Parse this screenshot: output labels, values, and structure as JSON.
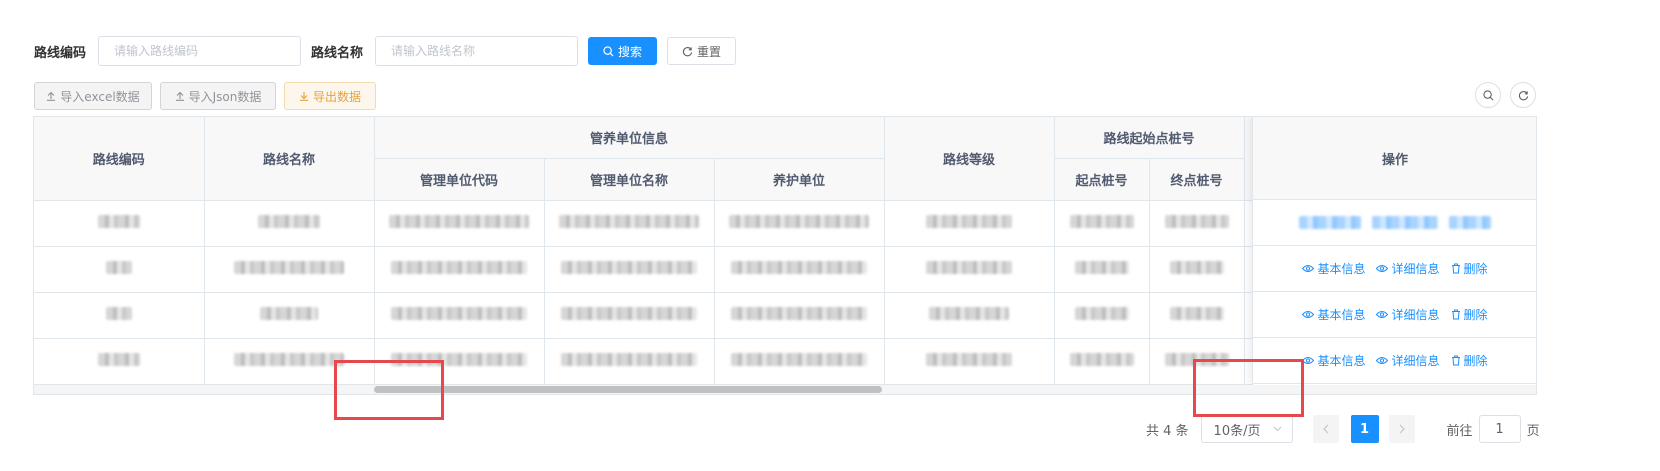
{
  "search": {
    "code_label": "路线编码",
    "code_placeholder": "请输入路线编码",
    "name_label": "路线名称",
    "name_placeholder": "请输入路线名称",
    "search_btn": "搜索",
    "reset_btn": "重置"
  },
  "toolbar": {
    "import_excel": "导入excel数据",
    "import_json": "导入Json数据",
    "export": "导出数据"
  },
  "table": {
    "headers": {
      "route_code": "路线编码",
      "route_name": "路线名称",
      "mgmt_group": "管养单位信息",
      "mgmt_code": "管理单位代码",
      "mgmt_name": "管理单位名称",
      "maint_unit": "养护单位",
      "route_level": "路线等级",
      "stake_group": "路线起始点桩号",
      "start_stake": "起点桩号",
      "end_stake": "终点桩号",
      "actions": "操作"
    },
    "row_count": 4,
    "row_actions": {
      "basic_info": "基本信息",
      "detail_info": "详细信息",
      "delete": "删除"
    }
  },
  "pagination": {
    "total": "共 4 条",
    "page_size": "10条/页",
    "current_page": "1",
    "goto_label": "前往",
    "goto_value": "1",
    "page_unit": "页"
  },
  "colors": {
    "primary": "#1890ff",
    "warning": "#e6a23c",
    "highlight": "#e5484d"
  }
}
